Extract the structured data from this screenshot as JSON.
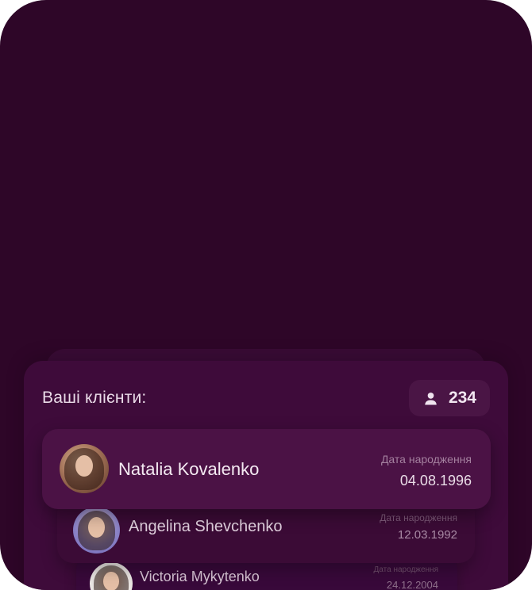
{
  "panel": {
    "title": "Ваші клієнти:",
    "count": "234",
    "count_icon": "person-icon"
  },
  "clients": [
    {
      "name": "Natalia Kovalenko",
      "dob_label": "Дата народження",
      "dob": "04.08.1996"
    },
    {
      "name": "Angelina Shevchenko",
      "dob_label": "Дата народження",
      "dob": "12.03.1992"
    },
    {
      "name": "Victoria Mykytenko",
      "dob_label": "Дата народження",
      "dob": "24.12.2004"
    }
  ],
  "colors": {
    "background": "#2e0628",
    "panel": "#3e0b3a",
    "card_active": "#4b1245",
    "text_primary": "#f4eaf2",
    "text_muted": "#a4809f"
  }
}
